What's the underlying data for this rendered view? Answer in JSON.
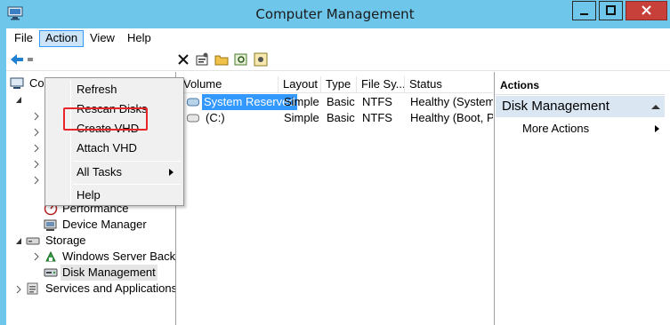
{
  "window": {
    "title": "Computer Management",
    "controls": {
      "minimize": "minimize",
      "maximize": "maximize",
      "close": "close"
    }
  },
  "menubar": {
    "items": [
      "File",
      "Action",
      "View",
      "Help"
    ],
    "active": "Action"
  },
  "action_menu": {
    "items": [
      "Refresh",
      "Rescan Disks",
      "Create VHD",
      "Attach VHD",
      "All Tasks",
      "Help"
    ],
    "highlighted": "Attach VHD"
  },
  "tree": {
    "root_label_visible": "Co",
    "items": [
      {
        "label": "Performance",
        "icon": "performance-icon"
      },
      {
        "label": "Device Manager",
        "icon": "device-manager-icon"
      },
      {
        "label": "Storage",
        "icon": "storage-icon"
      },
      {
        "label": "Windows Server Backup",
        "icon": "backup-icon"
      },
      {
        "label": "Disk Management",
        "icon": "disk-management-icon"
      },
      {
        "label": "Services and Applications",
        "icon": "services-icon"
      }
    ],
    "selected": "Disk Management"
  },
  "volumes": {
    "columns": [
      "Volume",
      "Layout",
      "Type",
      "File Sy...",
      "Status"
    ],
    "rows": [
      {
        "volume": "System Reserved",
        "layout": "Simple",
        "type": "Basic",
        "fs": "NTFS",
        "status": "Healthy (System, A"
      },
      {
        "volume": "(C:)",
        "layout": "Simple",
        "type": "Basic",
        "fs": "NTFS",
        "status": "Healthy (Boot, Pa"
      }
    ]
  },
  "actions_pane": {
    "title": "Actions",
    "section": "Disk Management",
    "items": [
      "More Actions"
    ]
  },
  "colors": {
    "titlebar": "#6ec6ea",
    "selection": "#3399ff",
    "section_bg": "#dae6f2",
    "highlight_box": "#e8262a",
    "close_button": "#c7403a"
  }
}
